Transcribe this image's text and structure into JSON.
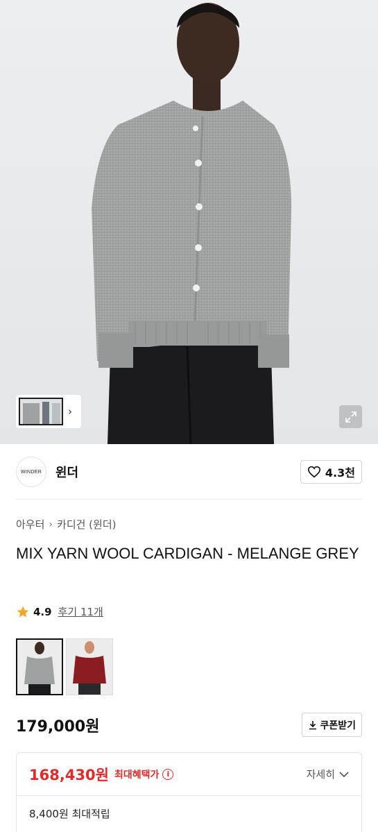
{
  "hero": {
    "image_alt": "Model wearing grey wool cardigan",
    "thumb_arrow": "›"
  },
  "brand": {
    "logo_text": "WINDER",
    "name": "윈더",
    "like_count": "4.3천"
  },
  "breadcrumb": {
    "items": [
      "아우터",
      "카디건 (윈더)"
    ],
    "separator": "›"
  },
  "product": {
    "title": "MIX YARN WOOL CARDIGAN - MELANGE GREY",
    "rating": "4.9",
    "reviews_label": "후기 11개"
  },
  "variants": [
    {
      "color": "#9ea19f",
      "label": "grey"
    },
    {
      "color": "#8a1c22",
      "label": "red"
    }
  ],
  "pricing": {
    "price": "179,000원",
    "coupon_label": "쿠폰받기",
    "max_benefit_price": "168,430원",
    "max_benefit_label": "최대혜택가",
    "detail_label": "자세히",
    "max_points": "8,400원 최대적립"
  },
  "colors": {
    "accent_red": "#e22a2a",
    "star": "#f5a623"
  }
}
